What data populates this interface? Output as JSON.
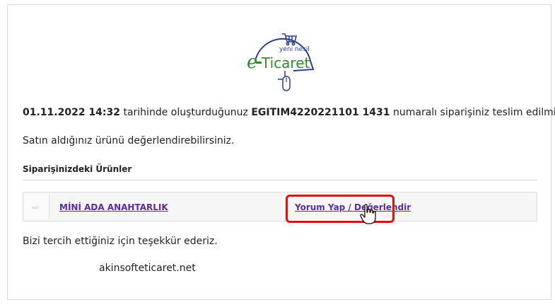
{
  "logo": {
    "brand_top": "yeni nesil",
    "brand_main": "e-Ticaret",
    "brand_e": "e",
    "brand_rest": "Ticaret",
    "icon_cart": "cart-icon",
    "icon_mouse": "mouse-icon"
  },
  "message": {
    "date": "01.11.2022 14:32",
    "text_a": " tarihinde oluşturduğunuz ",
    "order_no": "EGITIM4220221101 1431",
    "text_b": " numaralı siparişiniz teslim edilmiştir.",
    "rate_prompt": "Satın aldığınız ürünü değerlendirebilirsiniz."
  },
  "products": {
    "section_title": "Siparişinizdeki Ürünler",
    "items": [
      {
        "name": "MİNİ ADA ANAHTARLIK",
        "action_label": "Yorum Yap / Değerlendir"
      }
    ]
  },
  "footer": {
    "thanks": "Bizi tercih ettiğiniz için teşekkür ederiz.",
    "site": "akinsofteticaret.net"
  },
  "colors": {
    "brand_green": "#2e8b2e",
    "brand_blue": "#2a3f8f",
    "link": "#5b2c9c",
    "highlight": "#e01010"
  }
}
